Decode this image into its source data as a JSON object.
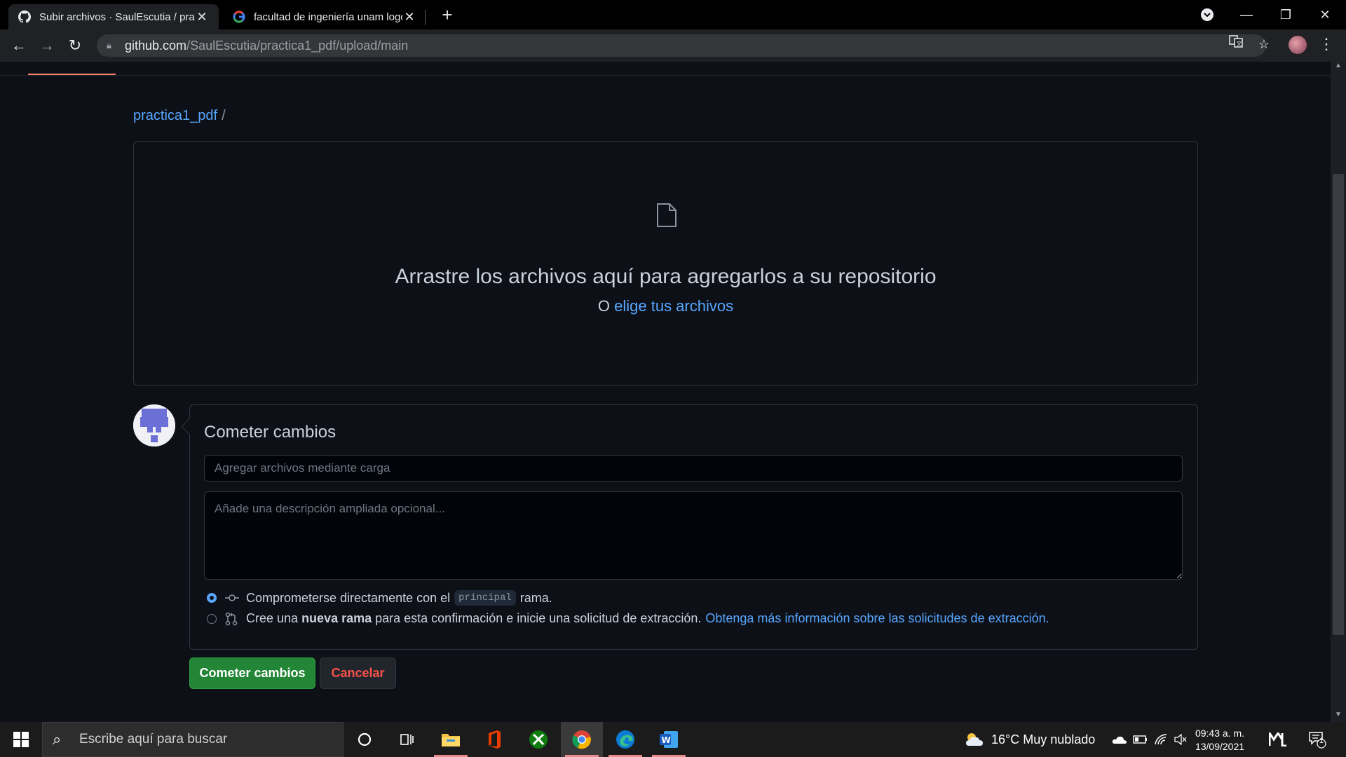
{
  "browser": {
    "tabs": [
      {
        "title": "Subir archivos · SaulEscutia / prac",
        "active": true
      },
      {
        "title": "facultad de ingeniería unam logo",
        "active": false
      }
    ],
    "url_host": "github.com",
    "url_path": "/SaulEscutia/practica1_pdf/upload/main"
  },
  "breadcrumb": {
    "repo": "practica1_pdf",
    "separator": "/"
  },
  "dropzone": {
    "title": "Arrastre los archivos aquí para agregarlos a su repositorio",
    "or_text": "O",
    "choose_link": "elige tus archivos"
  },
  "commit": {
    "heading": "Cometer cambios",
    "summary_placeholder": "Agregar archivos mediante carga",
    "description_placeholder": "Añade una descripción ampliada opcional...",
    "option_direct": {
      "before": "Comprometerse directamente con el",
      "branch": "principal",
      "after": "rama.",
      "checked": true
    },
    "option_new_branch": {
      "before": "Cree una",
      "bold": "nueva rama",
      "after": "para esta confirmación e inicie una solicitud de extracción.",
      "link": "Obtenga más información sobre las solicitudes de extracción.",
      "checked": false
    },
    "submit_label": "Cometer cambios",
    "cancel_label": "Cancelar"
  },
  "taskbar": {
    "search_placeholder": "Escribe aquí para buscar",
    "weather": "16°C  Muy nublado",
    "time": "09:43 a. m.",
    "date": "13/09/2021",
    "notification_count": "1"
  },
  "colors": {
    "accent_link": "#58a6ff",
    "commit_green": "#238636",
    "cancel_red": "#f85149",
    "background": "#0d1117"
  }
}
